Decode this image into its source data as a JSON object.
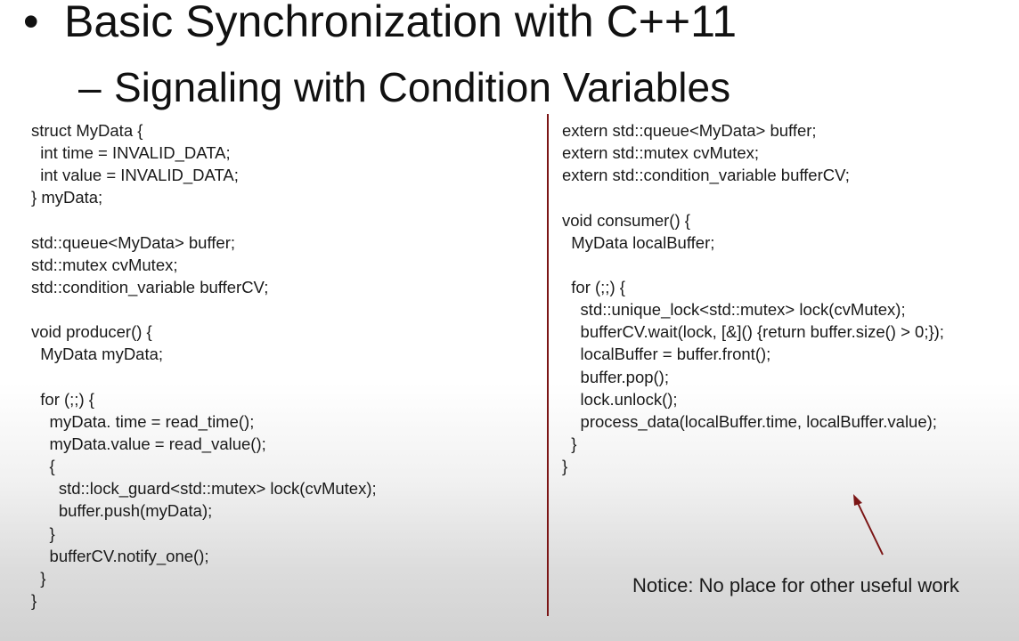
{
  "slide": {
    "bullet": "•",
    "title": "Basic Synchronization with C++11",
    "subtitle_dash": "–",
    "subtitle": "Signaling with Condition Variables"
  },
  "code_left": {
    "lines": [
      "struct MyData {",
      "  int time = INVALID_DATA;",
      "  int value = INVALID_DATA;",
      "} myData;",
      "",
      "std::queue<MyData> buffer;",
      "std::mutex cvMutex;",
      "std::condition_variable bufferCV;",
      "",
      "void producer() {",
      "  MyData myData;",
      "",
      "  for (;;) {",
      "    myData. time = read_time();",
      "    myData.value = read_value();",
      "    {",
      "      std::lock_guard<std::mutex> lock(cvMutex);",
      "      buffer.push(myData);",
      "    }",
      "    bufferCV.notify_one();",
      "  }",
      "}"
    ]
  },
  "code_right": {
    "lines": [
      "extern std::queue<MyData> buffer;",
      "extern std::mutex cvMutex;",
      "extern std::condition_variable bufferCV;",
      "",
      "void consumer() {",
      "  MyData localBuffer;",
      "",
      "  for (;;) {",
      "    std::unique_lock<std::mutex> lock(cvMutex);",
      "    bufferCV.wait(lock, [&]() {return buffer.size() > 0;});",
      "    localBuffer = buffer.front();",
      "    buffer.pop();",
      "    lock.unlock();",
      "    process_data(localBuffer.time, localBuffer.value);",
      "  }",
      "}"
    ]
  },
  "notice": {
    "text": "Notice: No place for other useful work"
  },
  "colors": {
    "divider": "#7b1515",
    "arrow": "#7b1515",
    "text": "#1a1a1a"
  },
  "icons": {
    "arrow": "arrow-up-left-icon"
  }
}
